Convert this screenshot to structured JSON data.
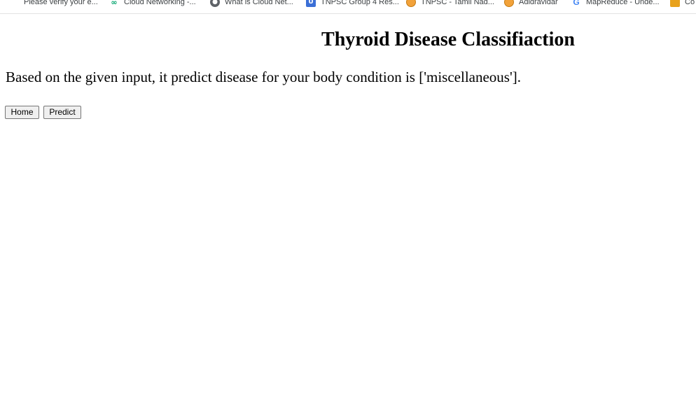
{
  "bookmarks": [
    {
      "label": "Please verify your e...",
      "icon": "mail-icon"
    },
    {
      "label": "Cloud Networking -...",
      "icon": "cloud-icon"
    },
    {
      "label": "What is Cloud Net...",
      "icon": "globe-icon"
    },
    {
      "label": "TNPSC Group 4 Res...",
      "icon": "u-icon"
    },
    {
      "label": "TNPSC - Tamil Nad...",
      "icon": "tnpsc-icon"
    },
    {
      "label": "Adidravidar",
      "icon": "tnpsc-icon"
    },
    {
      "label": "MapReduce - Unde...",
      "icon": "google-icon"
    },
    {
      "label": "Co",
      "icon": "folder-icon"
    }
  ],
  "page": {
    "title": "Thyroid Disease Classifiaction",
    "result": "Based on the given input, it predict disease for your body condition is ['miscellaneous']."
  },
  "buttons": {
    "home": "Home",
    "predict": "Predict"
  },
  "colors": {
    "background": "#ffffff",
    "text": "#000000",
    "button_bg": "#efefef",
    "button_border": "#767676"
  }
}
